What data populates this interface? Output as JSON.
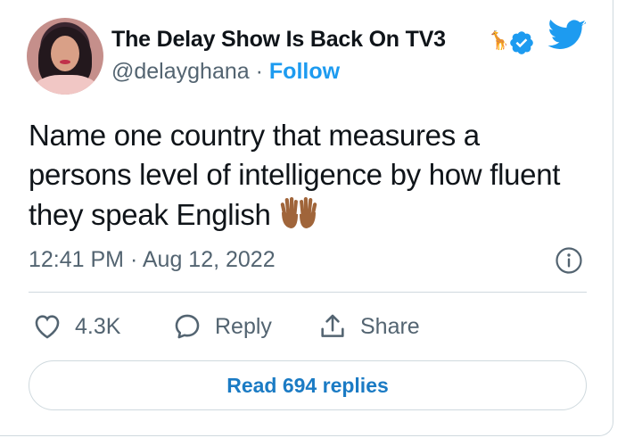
{
  "author": {
    "display_name": "The Delay Show Is Back On TV3",
    "handle": "@delayghana",
    "separator": "·",
    "follow_label": "Follow"
  },
  "tweet": {
    "text": "Name one country that measures a persons level of intelligence by how fluent they speak English",
    "emoji_icon": "raising-hands-icon",
    "time": "12:41 PM",
    "separator": "·",
    "date": "Aug 12, 2022"
  },
  "actions": {
    "like_count": "4.3K",
    "reply_label": "Reply",
    "share_label": "Share"
  },
  "read_replies_label": "Read 694 replies",
  "colors": {
    "accent": "#1d9bf0",
    "secondary_text": "#536471",
    "border": "#cfd9de",
    "replies_link": "#1b7bc4"
  }
}
